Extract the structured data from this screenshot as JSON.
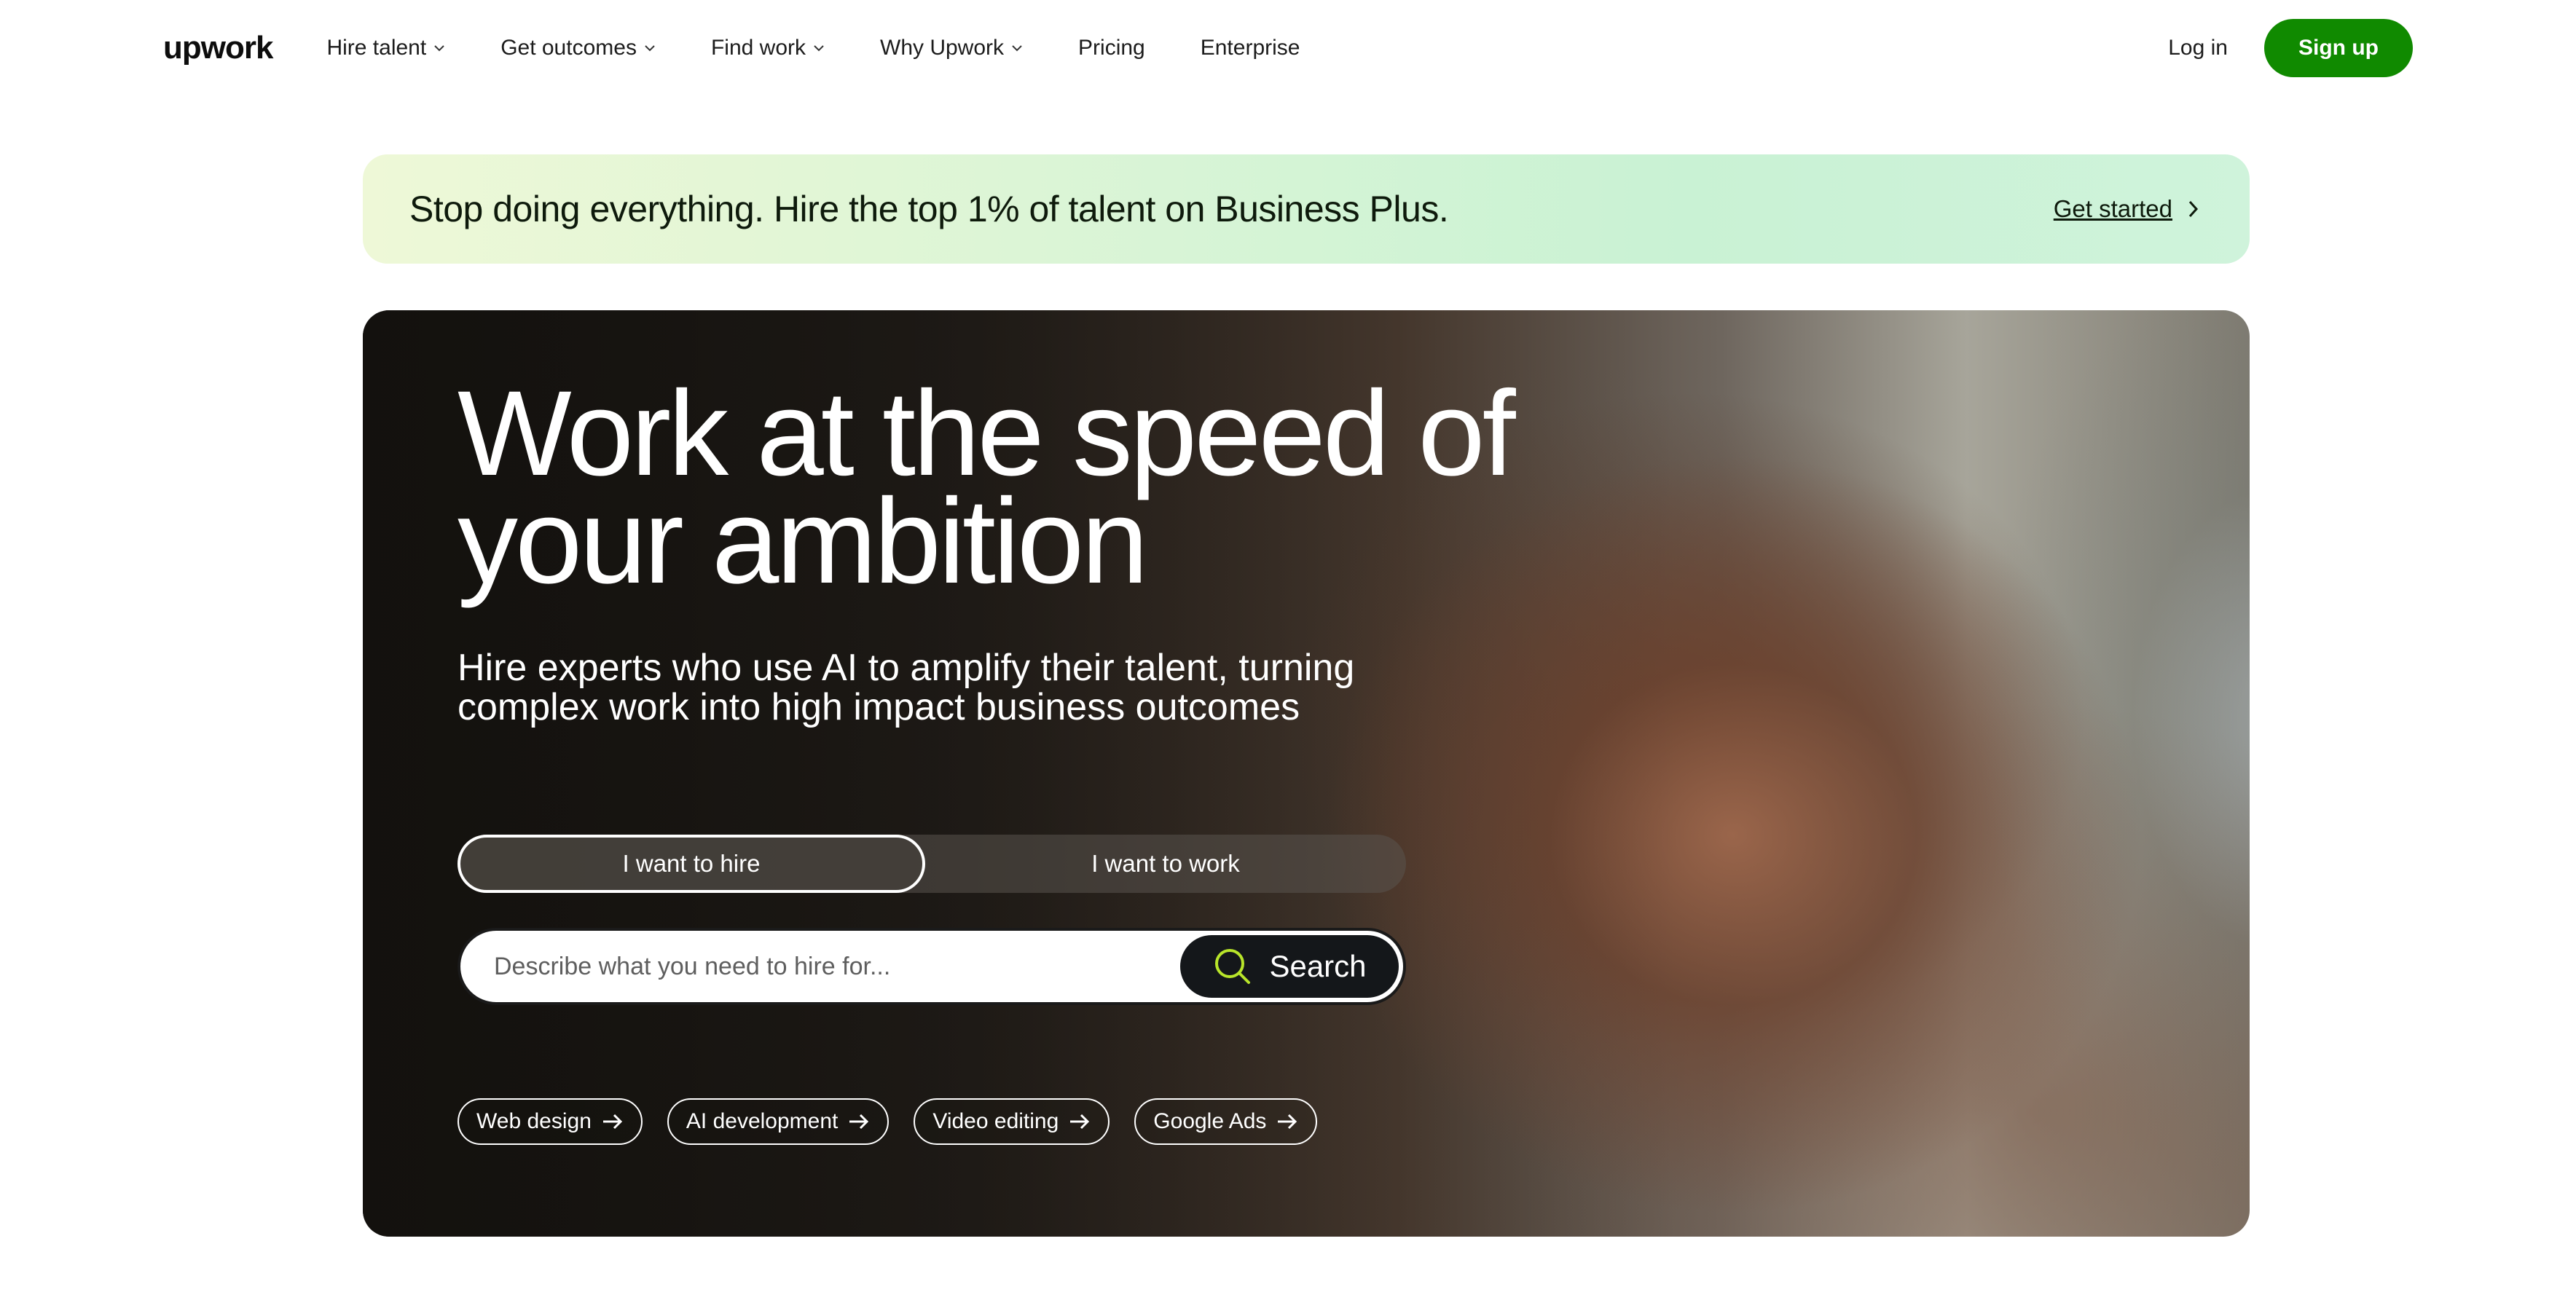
{
  "nav": {
    "logo": "upwork",
    "menu": [
      {
        "label": "Hire talent",
        "has_dropdown": true
      },
      {
        "label": "Get outcomes",
        "has_dropdown": true
      },
      {
        "label": "Find work",
        "has_dropdown": true
      },
      {
        "label": "Why Upwork",
        "has_dropdown": true
      },
      {
        "label": "Pricing",
        "has_dropdown": false
      },
      {
        "label": "Enterprise",
        "has_dropdown": false
      }
    ],
    "login": "Log in",
    "signup": "Sign up"
  },
  "promo": {
    "text": "Stop doing everything. Hire the top 1% of talent on Business Plus.",
    "cta": "Get started"
  },
  "hero": {
    "headline": "Work at the speed of your ambition",
    "subhead": "Hire experts who use AI to amplify their talent, turning complex work into high impact business outcomes",
    "toggle": {
      "hire": "I want to hire",
      "work": "I want to work",
      "selected": "hire"
    },
    "search": {
      "placeholder": "Describe what you need to hire for...",
      "value": "",
      "button": "Search"
    },
    "chips": [
      "Web design",
      "AI development",
      "Video editing",
      "Google Ads"
    ]
  },
  "colors": {
    "brand_green": "#108a00",
    "search_icon_green": "#b8e52a",
    "text_dark": "#001e00"
  },
  "icons": {
    "chevron": "chevron-down-icon",
    "promo_arrow": "chevron-right-icon",
    "search": "search-icon",
    "chip_arrow": "arrow-right-icon"
  }
}
